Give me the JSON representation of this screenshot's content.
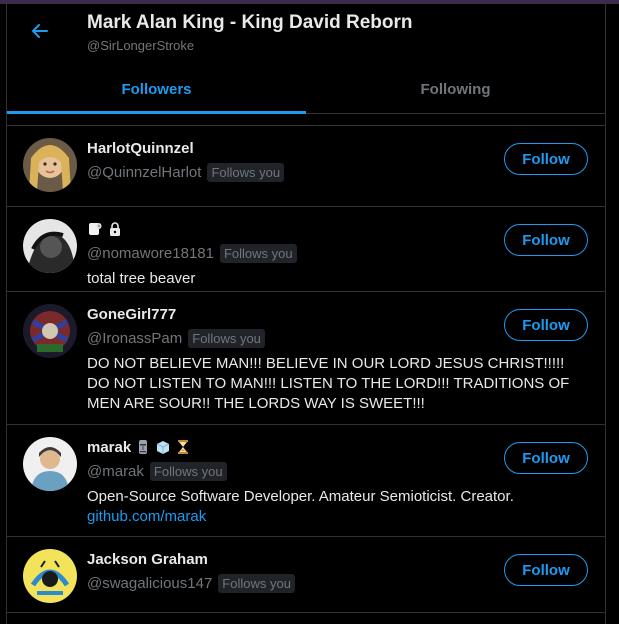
{
  "header": {
    "title": "Mark Alan King - King David Reborn",
    "handle": "@SirLongerStroke"
  },
  "tabs": [
    {
      "label": "Followers",
      "active": true
    },
    {
      "label": "Following",
      "active": false
    }
  ],
  "users": [
    {
      "name": "HarlotQuinnzel",
      "handle": "@QuinnzelHarlot",
      "badge": "Follows you",
      "bio": "",
      "button": "Follow"
    },
    {
      "name": "",
      "name_icons": [
        "toilet-paper-icon",
        "lock-icon"
      ],
      "handle": "@nomawore18181",
      "badge": "Follows you",
      "bio": "total tree beaver",
      "button": "Follow"
    },
    {
      "name": "GoneGirl777",
      "handle": "@IronassPam",
      "badge": "Follows you",
      "bio": "DO NOT BELIEVE MAN!!! BELIEVE IN OUR LORD JESUS CHRIST!!!!! DO NOT LISTEN TO MAN!!! LISTEN TO THE LORD!!! TRADITIONS OF MEN ARE SOUR!! THE LORDS WAY IS SWEET!!!",
      "button": "Follow"
    },
    {
      "name": "marak",
      "name_icons": [
        "moai-icon",
        "ice-cube-icon",
        "hourglass-icon"
      ],
      "handle": "@marak",
      "badge": "Follows you",
      "bio": "Open-Source Software Developer. Amateur Semioticist. Creator.",
      "link": "github.com/marak",
      "button": "Follow"
    },
    {
      "name": "Jackson Graham",
      "handle": "@swagalicious147",
      "badge": "Follows you",
      "bio": "",
      "button": "Follow"
    }
  ],
  "colors": {
    "accent": "#1d9bf0",
    "background": "#000000",
    "muted": "#71767b",
    "border": "#2f3336"
  }
}
